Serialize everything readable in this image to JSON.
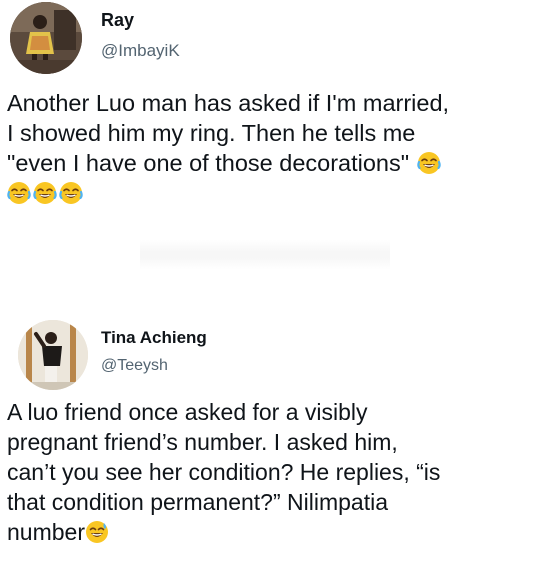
{
  "tweets": [
    {
      "display_name": "Ray",
      "handle": "@ImbayiK",
      "text": "Another Luo man has asked if I'm married,\nI showed him my ring. Then he tells me\n\"even I have one of those decorations\"",
      "emoji": "face-with-tears-of-joy",
      "emoji_count": 4
    },
    {
      "display_name": "Tina Achieng",
      "handle": "@Teeysh",
      "text": "A luo friend once asked for a visibly\npregnant friend’s number. I asked him,\ncan’t you see her condition? He replies, “is\nthat condition permanent?” Nilimpatia\nnumber",
      "emoji": "grinning-face-with-sweat",
      "emoji_count": 1
    }
  ],
  "colors": {
    "text": "#0f1419",
    "handle": "#536471",
    "emoji_face": "#f9c623"
  }
}
